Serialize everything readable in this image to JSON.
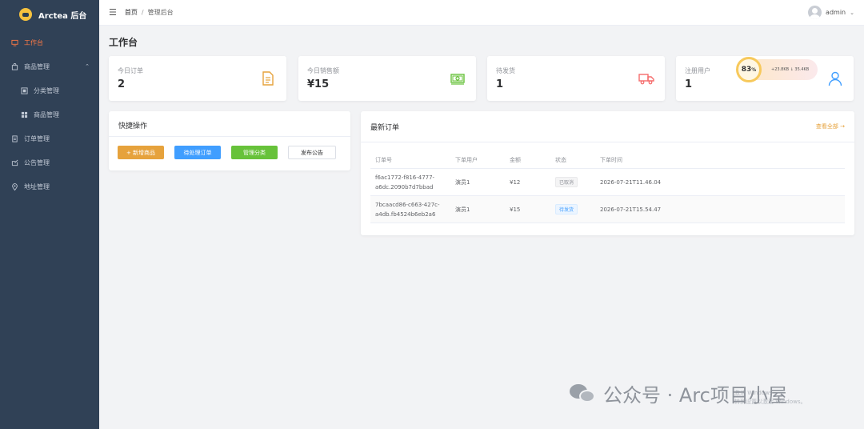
{
  "brand": {
    "title": "Arctea 后台"
  },
  "sidebar": {
    "items": [
      {
        "label": "工作台",
        "icon": "monitor-icon",
        "active": true
      },
      {
        "label": "商品管理",
        "icon": "bag-icon",
        "expanded": true
      },
      {
        "label": "分类管理",
        "icon": "category-icon",
        "sub": true
      },
      {
        "label": "商品管理",
        "icon": "grid-icon",
        "sub": true
      },
      {
        "label": "订单管理",
        "icon": "order-icon"
      },
      {
        "label": "公告管理",
        "icon": "notice-icon"
      },
      {
        "label": "地址管理",
        "icon": "location-icon"
      }
    ]
  },
  "header": {
    "breadcrumb": [
      "首页",
      "管理后台"
    ],
    "user": "admin"
  },
  "page": {
    "title": "工作台"
  },
  "stats": [
    {
      "label": "今日订单",
      "value": "2",
      "icon": "document-icon",
      "color": "#e6a23c"
    },
    {
      "label": "今日销售额",
      "value": "¥15",
      "icon": "money-icon",
      "color": "#67c23a"
    },
    {
      "label": "待发货",
      "value": "1",
      "icon": "truck-icon",
      "color": "#f56c6c"
    },
    {
      "label": "注册用户",
      "value": "1",
      "icon": "user-icon",
      "color": "#409eff"
    }
  ],
  "promo": {
    "percent": "83",
    "percent_unit": "%",
    "text": "+23.8KB ↓ 35.4KB"
  },
  "quick": {
    "title": "快捷操作",
    "buttons": [
      "+ 新增商品",
      "待处理订单",
      "管理分类",
      "发布公告"
    ]
  },
  "orders": {
    "title": "最新订单",
    "view_all": "查看全部 →",
    "columns": [
      "订单号",
      "下单用户",
      "金额",
      "状态",
      "下单时间"
    ],
    "rows": [
      {
        "id_line1": "f6ac1772-f816-4777-",
        "id_line2": "a6dc.2090b7d7bbad",
        "user": "演员1",
        "amount": "¥12",
        "status": "已取消",
        "status_color": "#909399",
        "time": "2026-07-21T11.46.04"
      },
      {
        "id_line1": "7bcaacd86-c663-427c-",
        "id_line2": "a4db.fb4524b6eb2a6",
        "user": "演员1",
        "amount": "¥15",
        "status": "待发货",
        "status_color": "#409eff",
        "time": "2026-07-21T15.54.47"
      }
    ]
  },
  "watermark": {
    "text": "公众号 · Arc项目小屋",
    "small_line1": "激活 Windows",
    "small_line2": "转到设置以激活 Windows。"
  }
}
